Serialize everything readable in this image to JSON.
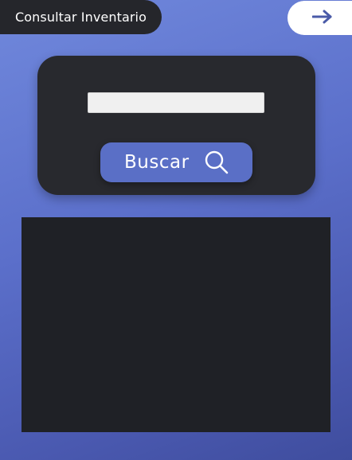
{
  "header": {
    "title": "Consultar Inventario",
    "next_icon": "arrow-right-icon"
  },
  "search": {
    "input_value": "",
    "input_placeholder": "",
    "button_label": "Buscar",
    "button_icon": "search-icon"
  },
  "results": {
    "rows": []
  },
  "colors": {
    "background_top": "#7088dc",
    "background_bottom": "#3f4d9e",
    "card": "#28292e",
    "button": "#5a6fc6",
    "results_panel": "#1f2126",
    "arrow": "#4a5ba8"
  }
}
